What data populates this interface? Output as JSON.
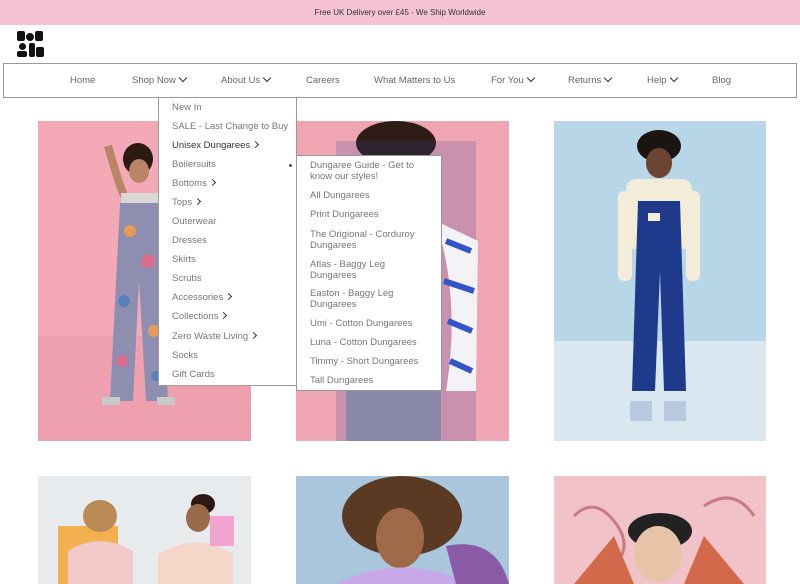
{
  "banner": {
    "text": "Free UK Delivery over £45 - We Ship Worldwide"
  },
  "nav": {
    "items": [
      {
        "label": "Home",
        "has_chevron": false
      },
      {
        "label": "Shop Now",
        "has_chevron": true
      },
      {
        "label": "About Us",
        "has_chevron": true
      },
      {
        "label": "Careers",
        "has_chevron": false
      },
      {
        "label": "What Matters to Us",
        "has_chevron": false
      },
      {
        "label": "For You",
        "has_chevron": true
      },
      {
        "label": "Returns",
        "has_chevron": true
      },
      {
        "label": "Help",
        "has_chevron": true
      },
      {
        "label": "Blog",
        "has_chevron": false
      }
    ]
  },
  "shop_menu": {
    "items": [
      {
        "label": "New In",
        "has_arrow": false
      },
      {
        "label": "SALE - Last Change to Buy",
        "has_arrow": false
      },
      {
        "label": "Unisex Dungarees",
        "has_arrow": true,
        "active": true
      },
      {
        "label": "Boilersuits",
        "has_arrow": false
      },
      {
        "label": "Bottoms",
        "has_arrow": true
      },
      {
        "label": "Tops",
        "has_arrow": true
      },
      {
        "label": "Outerwear",
        "has_arrow": false
      },
      {
        "label": "Dresses",
        "has_arrow": false
      },
      {
        "label": "Skirts",
        "has_arrow": false
      },
      {
        "label": "Scrubs",
        "has_arrow": false
      },
      {
        "label": "Accessories",
        "has_arrow": true
      },
      {
        "label": "Collections",
        "has_arrow": true
      },
      {
        "label": "Zero Waste Living",
        "has_arrow": true
      },
      {
        "label": "Socks",
        "has_arrow": false
      },
      {
        "label": "Gift Cards",
        "has_arrow": false
      }
    ]
  },
  "dungarees_menu": {
    "items": [
      {
        "label": "Dungaree Guide - Get to know our styles!"
      },
      {
        "label": "All Dungarees"
      },
      {
        "label": "Print Dungarees"
      },
      {
        "label": "The Origional - Corduroy Dungarees"
      },
      {
        "label": "Atlas - Baggy Leg Dungarees"
      },
      {
        "label": "Easton - Baggy Leg Dungarees"
      },
      {
        "label": "Umi - Cotton Dungarees"
      },
      {
        "label": "Luna - Cotton Dungarees"
      },
      {
        "label": "Timmy - Short Dungarees"
      },
      {
        "label": "Tall Dungarees"
      }
    ]
  },
  "colors": {
    "banner": "#f5c3d3",
    "pink_backdrop": "#f3a9b6",
    "blue_backdrop": "#b7d6e8",
    "denim": "#1f3a8a"
  }
}
